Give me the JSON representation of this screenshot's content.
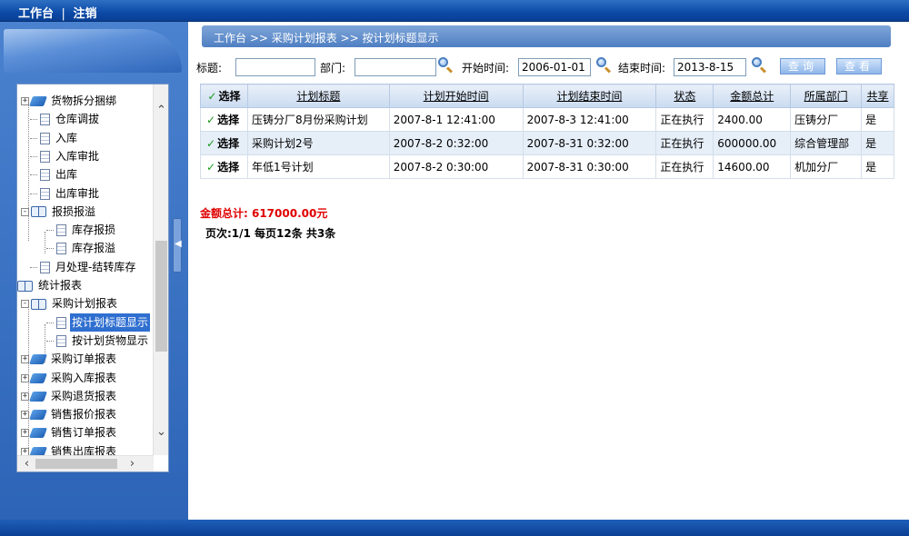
{
  "topbar": {
    "workbench": "工作台",
    "separator": "|",
    "logout": "注销"
  },
  "breadcrumb": "工作台 >> 采购计划报表 >> 按计划标题显示",
  "search": {
    "title_label": "标题:",
    "title_value": "",
    "dept_label": "部门:",
    "dept_value": "",
    "start_label": "开始时间:",
    "start_value": "2006-01-01",
    "end_label": "结束时间:",
    "end_value": "2013-8-15",
    "query_button": "查询",
    "view_button": "查看"
  },
  "tree": {
    "items": [
      {
        "label": "货物拆分捆绑",
        "icon": "book-icon",
        "expander": "+"
      },
      {
        "label": "仓库调拔",
        "icon": "doc-icon"
      },
      {
        "label": "入库",
        "icon": "doc-icon"
      },
      {
        "label": "入库审批",
        "icon": "doc-icon"
      },
      {
        "label": "出库",
        "icon": "doc-icon"
      },
      {
        "label": "出库审批",
        "icon": "doc-icon"
      },
      {
        "label": "报损报溢",
        "icon": "open-book-icon",
        "expander": "-"
      },
      {
        "label": "库存报损",
        "icon": "doc-icon"
      },
      {
        "label": "库存报溢",
        "icon": "doc-icon"
      },
      {
        "label": "月处理-结转库存",
        "icon": "doc-icon"
      },
      {
        "label": "统计报表",
        "icon": "open-book-icon"
      },
      {
        "label": "采购计划报表",
        "icon": "open-book-icon",
        "expander": "-"
      },
      {
        "label": "按计划标题显示",
        "icon": "doc-icon",
        "selected": true
      },
      {
        "label": "按计划货物显示",
        "icon": "doc-icon"
      },
      {
        "label": "采购订单报表",
        "icon": "book-icon",
        "expander": "+"
      },
      {
        "label": "采购入库报表",
        "icon": "book-icon",
        "expander": "+"
      },
      {
        "label": "采购退货报表",
        "icon": "book-icon",
        "expander": "+"
      },
      {
        "label": "销售报价报表",
        "icon": "book-icon",
        "expander": "+"
      },
      {
        "label": "销售订单报表",
        "icon": "book-icon",
        "expander": "+"
      },
      {
        "label": "销售出库报表",
        "icon": "book-icon",
        "expander": "+"
      }
    ]
  },
  "table": {
    "headers": [
      "选择",
      "计划标题",
      "计划开始时间",
      "计划结束时间",
      "状态",
      "金额总计",
      "所属部门",
      "共享"
    ],
    "select_label": "选择",
    "rows": [
      [
        "压铸分厂8月份采购计划",
        "2007-8-1 12:41:00",
        "2007-8-3 12:41:00",
        "正在执行",
        "2400.00",
        "压铸分厂",
        "是"
      ],
      [
        "采购计划2号",
        "2007-8-2 0:32:00",
        "2007-8-31 0:32:00",
        "正在执行",
        "600000.00",
        "综合管理部",
        "是"
      ],
      [
        "年低1号计划",
        "2007-8-2 0:30:00",
        "2007-8-31 0:30:00",
        "正在执行",
        "14600.00",
        "机加分厂",
        "是"
      ]
    ]
  },
  "summary": {
    "total": "金额总计: 617000.00元",
    "pager": "页次:1/1 每页12条 共3条"
  }
}
